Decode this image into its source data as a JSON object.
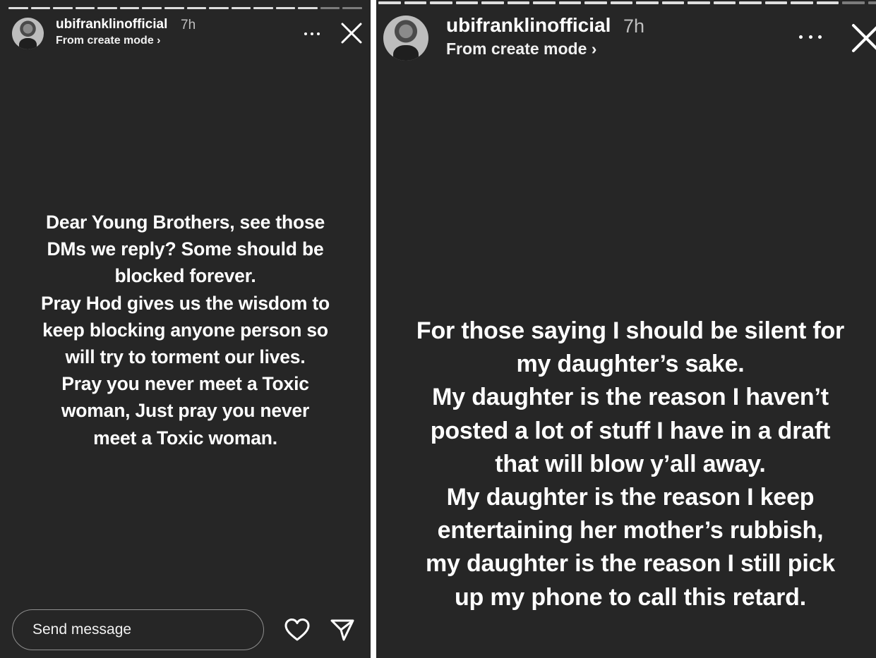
{
  "stories": [
    {
      "username": "ubifranklinofficial",
      "time": "7h",
      "subtitle": "From create mode ›",
      "text": "Dear Young Brothers, see those\nDMs we reply? Some should be\nblocked forever.\nPray Hod gives us the wisdom to\nkeep blocking anyone person so\nwill try to torment our lives.\nPray you never meet a Toxic\nwoman, Just pray you never\nmeet a Toxic woman.",
      "icons": [
        "avatar",
        "more-icon",
        "close-icon",
        "heart-icon",
        "send-icon"
      ]
    },
    {
      "username": "ubifranklinofficial",
      "time": "7h",
      "subtitle": "From create mode ›",
      "text": "For those saying I should be silent for\nmy daughter’s sake.\nMy daughter is the reason I haven’t\nposted a lot of stuff I have in a draft\nthat will blow y’all away.\nMy daughter is the reason I keep\nentertaining her mother’s rubbish,\nmy daughter is the reason  I still pick\nup my phone to call this retard.",
      "icons": [
        "avatar",
        "more-icon",
        "close-icon"
      ]
    }
  ],
  "reply": {
    "placeholder": "Send message"
  },
  "colors": {
    "story_background": "#262626",
    "text": "#ffffff",
    "input_border": "#8e8e8e"
  }
}
